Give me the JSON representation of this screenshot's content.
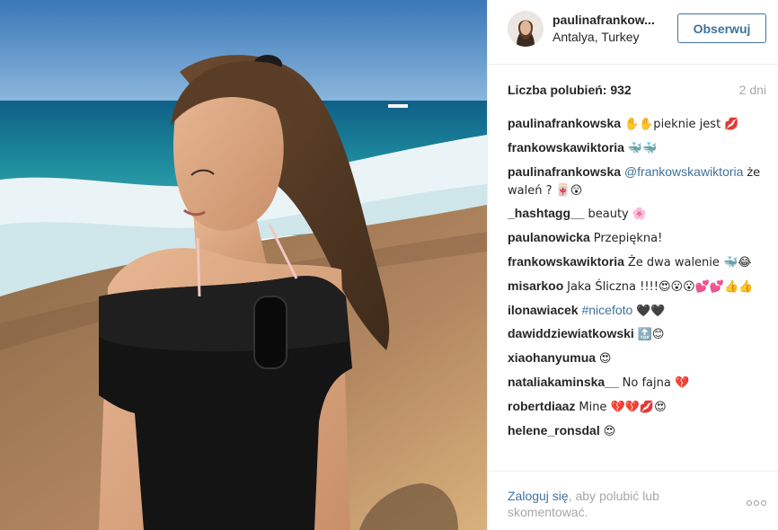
{
  "post": {
    "author_username": "paulinafrankow...",
    "location": "Antalya, Turkey",
    "follow_label": "Obserwuj",
    "likes_text": "Liczba polubień: 932",
    "age_text": "2 dni"
  },
  "comments": [
    {
      "user": "paulinafrankowska",
      "text": "✋✋pieknie jest 💋"
    },
    {
      "user": "frankowskawiktoria",
      "text": "🐳🐳"
    },
    {
      "user": "paulinafrankowska",
      "mention": "@frankowskawiktoria",
      "text": "że waleń ? 🀄😲"
    },
    {
      "user": "_hashtagg__",
      "text": "beauty 🌸"
    },
    {
      "user": "paulanowicka",
      "text": "Przepiękna!"
    },
    {
      "user": "frankowskawiktoria",
      "text": "Że dwa walenie 🐳😂"
    },
    {
      "user": "misarkoo",
      "text": "Jaka Śliczna !!!!😍😮😮💕💕👍👍"
    },
    {
      "user": "ilonawiacek",
      "hashtag": "#nicefoto",
      "text": "🖤🖤"
    },
    {
      "user": "dawiddziewiatkowski",
      "text": "🔝😊"
    },
    {
      "user": "xiaohanyumua",
      "text": "😍"
    },
    {
      "user": "nataliakaminska__",
      "text": "No fajna 💔"
    },
    {
      "user": "robertdiaaz",
      "text": "Mine 💔💔💋😍"
    },
    {
      "user": "helene_ronsdal",
      "text": "😍"
    }
  ],
  "footer": {
    "login_link": "Zaloguj się",
    "login_rest": ", aby polubić lub skomentować.",
    "more_icon": "ellipsis-icon"
  },
  "colors": {
    "accent": "#3f729b",
    "text": "#262626",
    "muted": "#a5a7aa",
    "border": "#efefef"
  }
}
